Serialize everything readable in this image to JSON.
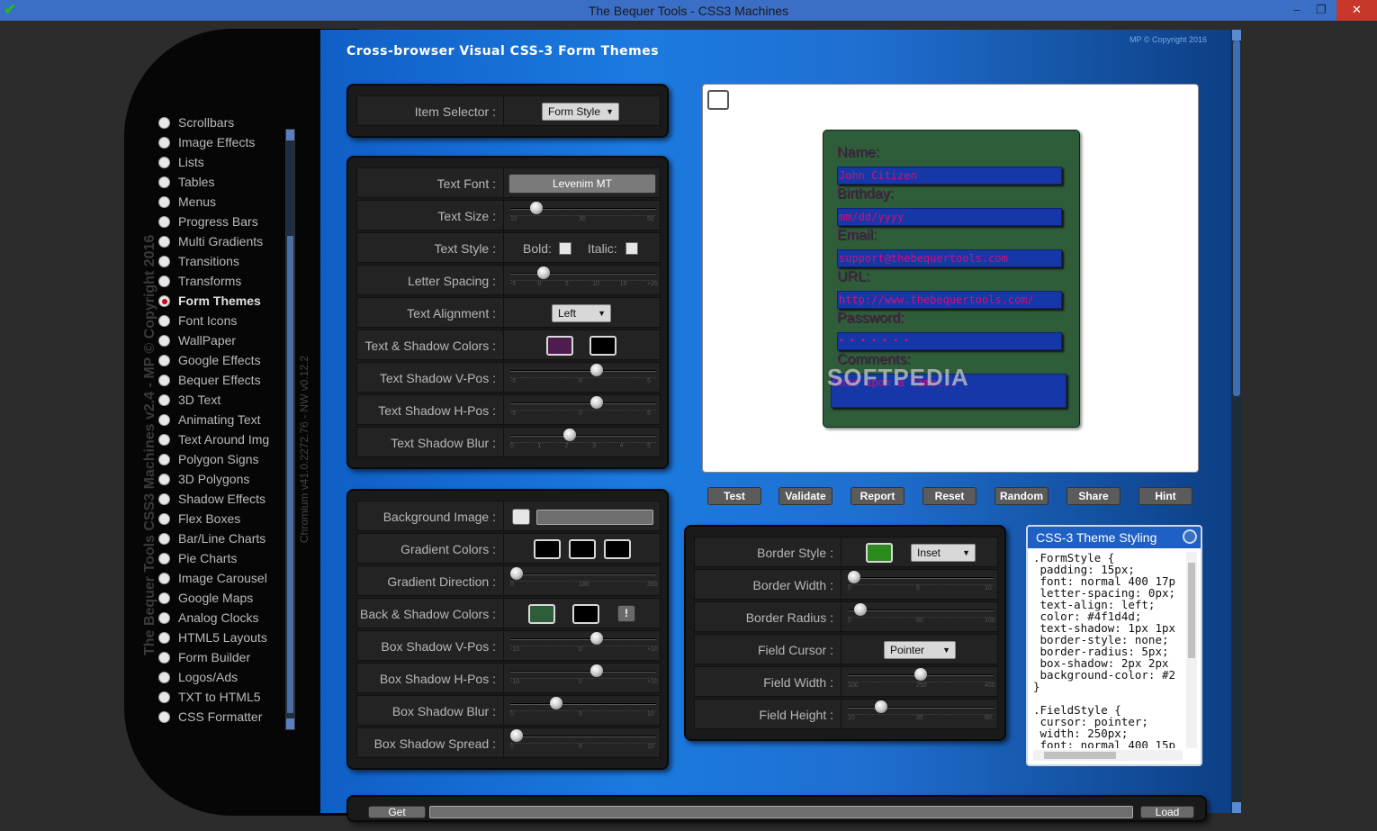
{
  "window": {
    "title": "The Bequer Tools - CSS3 Machines",
    "min": "–",
    "restore": "❐",
    "close": "✕",
    "app_icon": "check-icon"
  },
  "sidebar": {
    "vertical_title": "The Bequer Tools CSS3 Machines v2.4 - MP © Copyright 2016",
    "vertical_version": "Chromium v41.0.2272.76 - NW v0.12.2",
    "items": [
      {
        "label": "Scrollbars",
        "selected": false
      },
      {
        "label": "Image Effects",
        "selected": false
      },
      {
        "label": "Lists",
        "selected": false
      },
      {
        "label": "Tables",
        "selected": false
      },
      {
        "label": "Menus",
        "selected": false
      },
      {
        "label": "Progress Bars",
        "selected": false
      },
      {
        "label": "Multi Gradients",
        "selected": false
      },
      {
        "label": "Transitions",
        "selected": false
      },
      {
        "label": "Transforms",
        "selected": false
      },
      {
        "label": "Form Themes",
        "selected": true
      },
      {
        "label": "Font Icons",
        "selected": false
      },
      {
        "label": "WallPaper",
        "selected": false
      },
      {
        "label": "Google Effects",
        "selected": false
      },
      {
        "label": "Bequer Effects",
        "selected": false
      },
      {
        "label": "3D Text",
        "selected": false
      },
      {
        "label": "Animating Text",
        "selected": false
      },
      {
        "label": "Text Around Img",
        "selected": false
      },
      {
        "label": "Polygon Signs",
        "selected": false
      },
      {
        "label": "3D Polygons",
        "selected": false
      },
      {
        "label": "Shadow Effects",
        "selected": false
      },
      {
        "label": "Flex Boxes",
        "selected": false
      },
      {
        "label": "Bar/Line Charts",
        "selected": false
      },
      {
        "label": "Pie Charts",
        "selected": false
      },
      {
        "label": "Image Carousel",
        "selected": false
      },
      {
        "label": "Google Maps",
        "selected": false
      },
      {
        "label": "Analog Clocks",
        "selected": false
      },
      {
        "label": "HTML5 Layouts",
        "selected": false
      },
      {
        "label": "Form Builder",
        "selected": false
      },
      {
        "label": "Logos/Ads",
        "selected": false
      },
      {
        "label": "TXT to HTML5",
        "selected": false
      },
      {
        "label": "CSS Formatter",
        "selected": false
      }
    ]
  },
  "main": {
    "heading": "Cross-browser Visual CSS-3 Form Themes",
    "copyright": "MP © Copyright 2016",
    "item_selector": {
      "label": "Item Selector :",
      "value": "Form Style"
    },
    "text_panel": {
      "font": {
        "label": "Text Font :",
        "value": "Levenim MT"
      },
      "size": {
        "label": "Text Size :",
        "ticks": [
          "10",
          "30",
          "50"
        ],
        "min": 10,
        "max": 50,
        "value": 16
      },
      "style": {
        "label": "Text Style :",
        "bold": "Bold:",
        "italic": "Italic:"
      },
      "letter_spacing": {
        "label": "Letter Spacing :",
        "ticks": [
          "-5",
          "0",
          "5",
          "10",
          "15",
          "+20"
        ],
        "min": -5,
        "max": 20,
        "value": 0
      },
      "alignment": {
        "label": "Text Alignment :",
        "value": "Left"
      },
      "colors": {
        "label": "Text & Shadow Colors :",
        "text_color": "#4f1d4d",
        "shadow_color": "#000000"
      },
      "shadow_v": {
        "label": "Text Shadow V-Pos :",
        "ticks": [
          "-5",
          "0",
          "5"
        ],
        "min": -5,
        "max": 5,
        "value": 1
      },
      "shadow_h": {
        "label": "Text Shadow H-Pos :",
        "ticks": [
          "-5",
          "0",
          "5"
        ],
        "min": -5,
        "max": 5,
        "value": 1
      },
      "shadow_blur": {
        "label": "Text Shadow Blur :",
        "ticks": [
          "0",
          "1",
          "2",
          "3",
          "4",
          "5"
        ],
        "min": 0,
        "max": 5,
        "value": 2
      }
    },
    "bg_panel": {
      "bg_image": {
        "label": "Background Image :"
      },
      "gradient": {
        "label": "Gradient Colors :",
        "colors": [
          "#000000",
          "#000000",
          "#000000"
        ]
      },
      "direction": {
        "label": "Gradient Direction :",
        "ticks": [
          "0",
          "180",
          "360"
        ],
        "min": 0,
        "max": 360,
        "value": 0
      },
      "back_colors": {
        "label": "Back & Shadow Colors :",
        "back": "#2f5d3a",
        "shadow": "#000000",
        "bang": "!"
      },
      "box_v": {
        "label": "Box Shadow V-Pos :",
        "ticks": [
          "-10",
          "0",
          "+10"
        ],
        "min": -10,
        "max": 10,
        "value": 2
      },
      "box_h": {
        "label": "Box Shadow H-Pos :",
        "ticks": [
          "-10",
          "0",
          "+10"
        ],
        "min": -10,
        "max": 10,
        "value": 2
      },
      "box_blur": {
        "label": "Box Shadow Blur :",
        "ticks": [
          "0",
          "5",
          "10"
        ],
        "min": 0,
        "max": 10,
        "value": 3
      },
      "box_spread": {
        "label": "Box Shadow Spread :",
        "ticks": [
          "0",
          "5",
          "10"
        ],
        "min": 0,
        "max": 10,
        "value": 0
      }
    },
    "buttons": [
      "Test",
      "Validate",
      "Report",
      "Reset",
      "Random",
      "Share",
      "Hint"
    ],
    "border_panel": {
      "style": {
        "label": "Border Style :",
        "color": "#2d8a1e",
        "value": "Inset"
      },
      "width": {
        "label": "Border Width :",
        "ticks": [
          "0",
          "5",
          "10"
        ],
        "min": 0,
        "max": 10,
        "value": 0
      },
      "radius": {
        "label": "Border Radius :",
        "ticks": [
          "0",
          "50",
          "100"
        ],
        "min": 0,
        "max": 100,
        "value": 5
      },
      "cursor": {
        "label": "Field Cursor :",
        "value": "Pointer"
      },
      "field_width": {
        "label": "Field Width :",
        "ticks": [
          "100",
          "250",
          "400"
        ],
        "min": 100,
        "max": 400,
        "value": 250
      },
      "field_height": {
        "label": "Field Height :",
        "ticks": [
          "10",
          "35",
          "60"
        ],
        "min": 10,
        "max": 60,
        "value": 20
      }
    },
    "code": {
      "title": "CSS-3 Theme Styling",
      "text": ".FormStyle {\n padding: 15px;\n font: normal 400 17p\n letter-spacing: 0px;\n text-align: left;\n color: #4f1d4d;\n text-shadow: 1px 1px\n border-style: none;\n border-radius: 5px;\n box-shadow: 2px 2px\n background-color: #2\n}\n\n.FieldStyle {\n cursor: pointer;\n width: 250px;\n font: normal 400 15p"
    },
    "preview": {
      "labels": [
        "Name:",
        "Birthday:",
        "Email:",
        "URL:",
        "Password:",
        "Comments:"
      ],
      "values": [
        "John Citizen",
        "mm/dd/yyyy",
        "support@thebequertools.com",
        "http://www.thebequertools.com/",
        "• • • • • • •",
        "Once upon a time..."
      ],
      "watermark": "SOFTPEDIA"
    },
    "bottom": {
      "get": "Get",
      "load": "Load"
    }
  }
}
